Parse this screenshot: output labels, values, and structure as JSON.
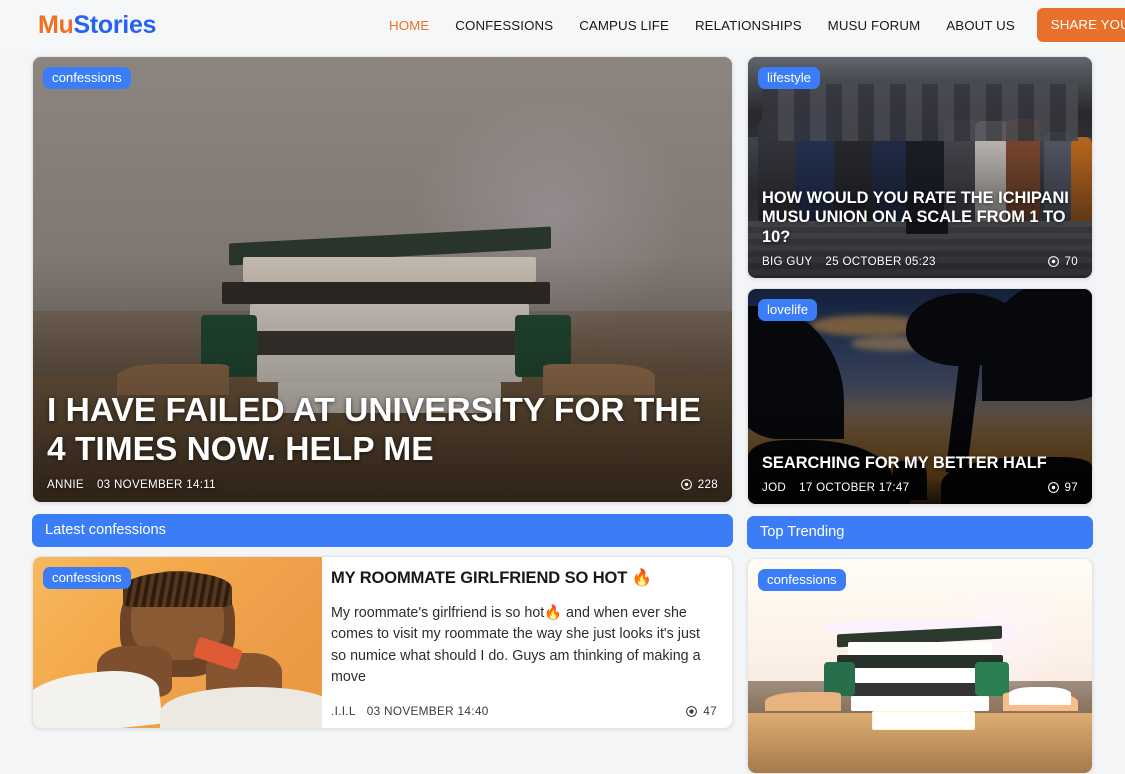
{
  "header": {
    "logo_mu": "Mu",
    "logo_stories": "Stories",
    "nav": [
      {
        "label": "HOME",
        "active": true
      },
      {
        "label": "CONFESSIONS",
        "active": false
      },
      {
        "label": "CAMPUS LIFE",
        "active": false
      },
      {
        "label": "RELATIONSHIPS",
        "active": false
      },
      {
        "label": "MUSU FORUM",
        "active": false
      },
      {
        "label": "ABOUT US",
        "active": false
      }
    ],
    "share_button": "SHARE YOUR STORY",
    "accent_orange": "#e8702a",
    "accent_blue": "#2563f0"
  },
  "hero": {
    "badge": "confessions",
    "title": "I HAVE FAILED AT UNIVERSITY FOR THE 4 TIMES NOW. HELP ME",
    "author": "ANNIE",
    "date": "03 NOVEMBER 14:11",
    "views": "228"
  },
  "lifestyle": {
    "badge": "lifestyle",
    "title": "HOW WOULD YOU RATE THE ICHIPANI MUSU UNION ON A SCALE FROM 1 TO 10?",
    "author": "BIG GUY",
    "date": "25 OCTOBER 05:23",
    "views": "70"
  },
  "lovelife": {
    "badge": "lovelife",
    "title": "SEARCHING FOR MY BETTER HALF",
    "author": "JOD",
    "date": "17 OCTOBER 17:47",
    "views": "97"
  },
  "sections": {
    "latest": "Latest confessions",
    "trending": "Top Trending"
  },
  "latest_post": {
    "badge": "confessions",
    "title": "MY ROOMMATE GIRLFRIEND SO HOT 🔥",
    "excerpt": "My roommate's girlfriend is so hot🔥 and when ever she comes to visit my roommate the way she just looks it's just so numice what should I do. Guys am thinking of making a move",
    "author": ".I.I.L",
    "date": "03 NOVEMBER 14:40",
    "views": "47"
  },
  "trending_post": {
    "badge": "confessions"
  },
  "icons": {
    "eye": "eye-icon"
  }
}
